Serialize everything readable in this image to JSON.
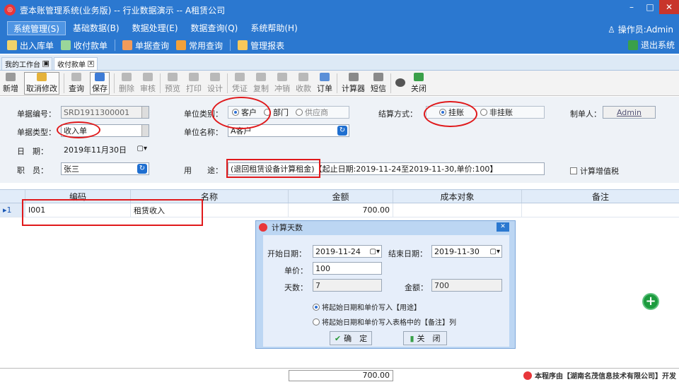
{
  "window": {
    "title": "壹本账管理系统(业务版) -- 行业数据演示 -- A租赁公司",
    "min": "–",
    "max": "□",
    "close": "✕"
  },
  "menu": {
    "items": [
      "系统管理(S)",
      "基础数据(B)",
      "数据处理(E)",
      "数据查询(Q)",
      "系统帮助(H)"
    ],
    "operator": "操作员:Admin"
  },
  "quick": {
    "items": [
      "出入库单",
      "收付款单",
      "单据查询",
      "常用查询",
      "管理报表"
    ],
    "exit": "退出系统"
  },
  "tabs": {
    "items": [
      "我的工作台",
      "收付款单"
    ],
    "close": "x"
  },
  "toolbar": {
    "items": [
      "新增",
      "取消修改",
      "查询",
      "保存",
      "删除",
      "审核",
      "预览",
      "打印",
      "设计",
      "凭证",
      "复制",
      "冲销",
      "收款",
      "订单",
      "计算器",
      "短信",
      "",
      "关闭"
    ]
  },
  "form": {
    "doc_no_label": "单据编号：",
    "doc_no": "SRD1911300001",
    "doc_type_label": "单据类型：",
    "doc_type": "收入单",
    "date_label": "日　期：",
    "date": "2019年11月30日",
    "staff_label": "职　员：",
    "staff": "张三",
    "unit_type_label": "单位类别：",
    "unit_types": [
      "客户",
      "部门",
      "供应商"
    ],
    "unit_name_label": "单位名称：",
    "unit_name": "A客户",
    "purpose_label": "用　　途：",
    "purpose_part1": "(退回租赁设备计算租金)",
    "purpose_part2": "【起止日期:2019-11-24至2019-11-30,单价:100】",
    "settle_label": "结算方式：",
    "settle_options": [
      "挂账",
      "非挂账"
    ],
    "maker_label": "制单人：",
    "maker": "Admin",
    "vat_label": "计算增值税"
  },
  "grid": {
    "headers": [
      "编码",
      "名称",
      "金额",
      "成本对象",
      "备注"
    ],
    "rows": [
      {
        "no": "1",
        "code": "I001",
        "name": "租赁收入",
        "amount": "700.00",
        "cost": "",
        "note": ""
      }
    ],
    "total": "700.00"
  },
  "dialog": {
    "title": "计算天数",
    "start_label": "开始日期：",
    "start": "2019-11-24",
    "end_label": "结束日期：",
    "end": "2019-11-30",
    "price_label": "单价：",
    "price": "100",
    "days_label": "天数：",
    "days": "7",
    "amount_label": "金额：",
    "amount": "700",
    "opt1": "将起始日期和单价写入【用途】",
    "opt2": "将起始日期和单价写入表格中的【备注】列",
    "ok": "确　定",
    "close": "关　闭"
  },
  "footer": {
    "brand": "本程序由【湖南名茂信息技术有限公司】开发"
  },
  "colors": {
    "title_bar": "#2b78d0",
    "accent_red": "#e0191b",
    "form_bg": "#eef2f7"
  }
}
